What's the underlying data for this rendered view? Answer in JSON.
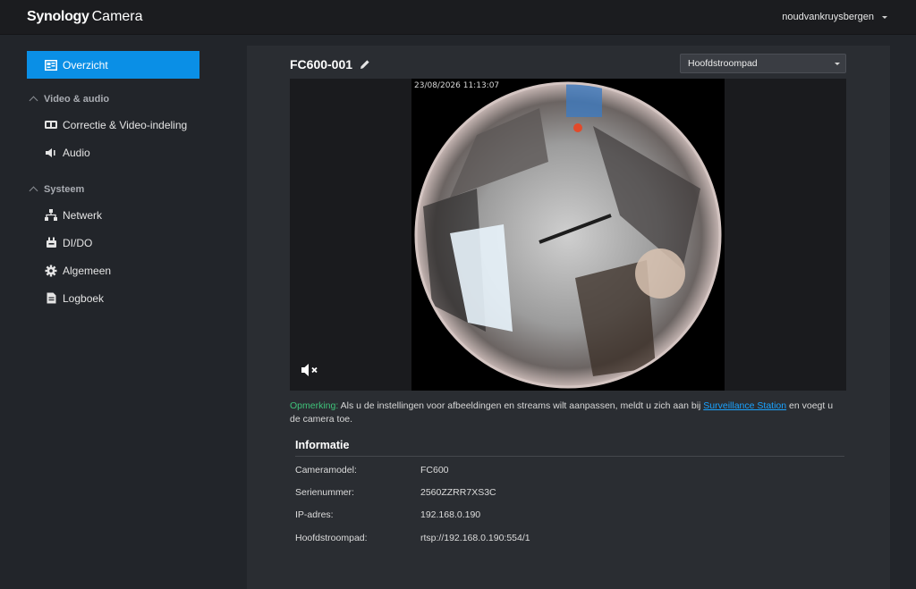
{
  "header": {
    "brand_bold": "Synology",
    "brand_light": "Camera",
    "username": "noudvankruysbergen"
  },
  "sidebar": {
    "overview": "Overzicht",
    "groups": [
      {
        "label": "Video & audio",
        "items": [
          {
            "label": "Correctie & Video-indeling",
            "icon": "video-layout-icon"
          },
          {
            "label": "Audio",
            "icon": "speaker-icon"
          }
        ]
      },
      {
        "label": "Systeem",
        "items": [
          {
            "label": "Netwerk",
            "icon": "network-icon"
          },
          {
            "label": "DI/DO",
            "icon": "dido-icon"
          },
          {
            "label": "Algemeen",
            "icon": "gear-icon"
          },
          {
            "label": "Logboek",
            "icon": "log-icon"
          }
        ]
      }
    ],
    "active_color": "#0a8fe6"
  },
  "main": {
    "camera_name": "FC600-001",
    "stream_select": "Hoofdstroompad",
    "timestamp": "23/08/2026 11:13:07",
    "note": {
      "label": "Opmerking:",
      "text_before": " Als u de instellingen voor afbeeldingen en streams wilt aanpassen, meldt u zich aan bij ",
      "link": "Surveillance Station",
      "text_after": " en voegt u de camera toe."
    },
    "info": {
      "title": "Informatie",
      "rows": [
        {
          "key": "Cameramodel:",
          "value": "FC600"
        },
        {
          "key": "Serienummer:",
          "value": "2560ZZRR7XS3C"
        },
        {
          "key": "IP-adres:",
          "value": "192.168.0.190"
        },
        {
          "key": "Hoofdstroompad:",
          "value": "rtsp://192.168.0.190:554/1"
        }
      ]
    }
  }
}
